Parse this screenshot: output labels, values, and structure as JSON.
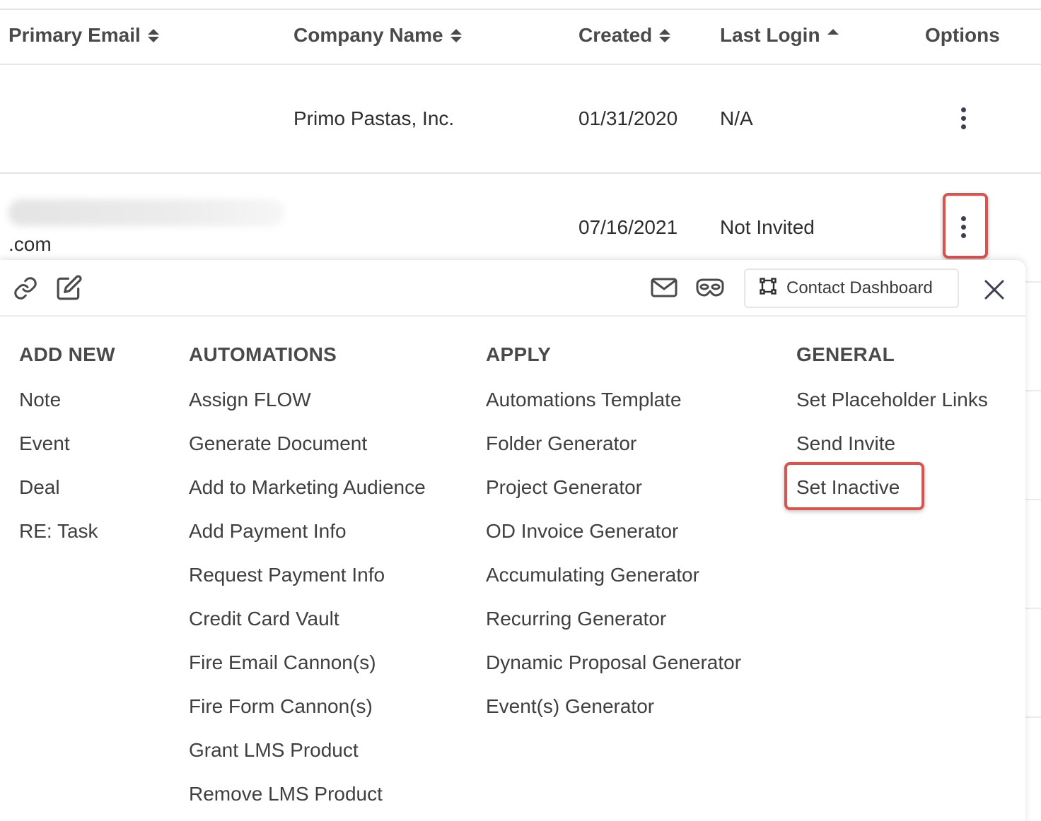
{
  "table": {
    "headers": {
      "primary_email": "Primary Email",
      "company_name": "Company Name",
      "created": "Created",
      "last_login": "Last Login",
      "options": "Options"
    },
    "rows": [
      {
        "email": "",
        "company": "Primo Pastas, Inc.",
        "created": "01/31/2020",
        "last_login": "N/A"
      },
      {
        "email": ".com",
        "company": "",
        "created": "07/16/2021",
        "last_login": "Not Invited"
      }
    ]
  },
  "panel": {
    "contact_dashboard_label": "Contact Dashboard",
    "icons": [
      "link-icon",
      "edit-icon",
      "mail-icon",
      "mask-icon",
      "dashboard-icon",
      "close-icon"
    ],
    "columns": [
      {
        "title": "ADD NEW",
        "items": [
          "Note",
          "Event",
          "Deal",
          "RE: Task"
        ]
      },
      {
        "title": "AUTOMATIONS",
        "items": [
          "Assign FLOW",
          "Generate Document",
          "Add to Marketing Audience",
          "Add Payment Info",
          "Request Payment Info",
          "Credit Card Vault",
          "Fire Email Cannon(s)",
          "Fire Form Cannon(s)",
          "Grant LMS Product",
          "Remove LMS Product"
        ]
      },
      {
        "title": "APPLY",
        "items": [
          "Automations Template",
          "Folder Generator",
          "Project Generator",
          "OD Invoice Generator",
          "Accumulating Generator",
          "Recurring Generator",
          "Dynamic Proposal Generator",
          "Event(s) Generator"
        ]
      },
      {
        "title": "GENERAL",
        "items": [
          "Set Placeholder Links",
          "Send Invite",
          "Set Inactive"
        ]
      }
    ]
  },
  "colors": {
    "highlight": "#d9534f",
    "text": "#3f3f3f",
    "border": "#e6e6e6"
  }
}
